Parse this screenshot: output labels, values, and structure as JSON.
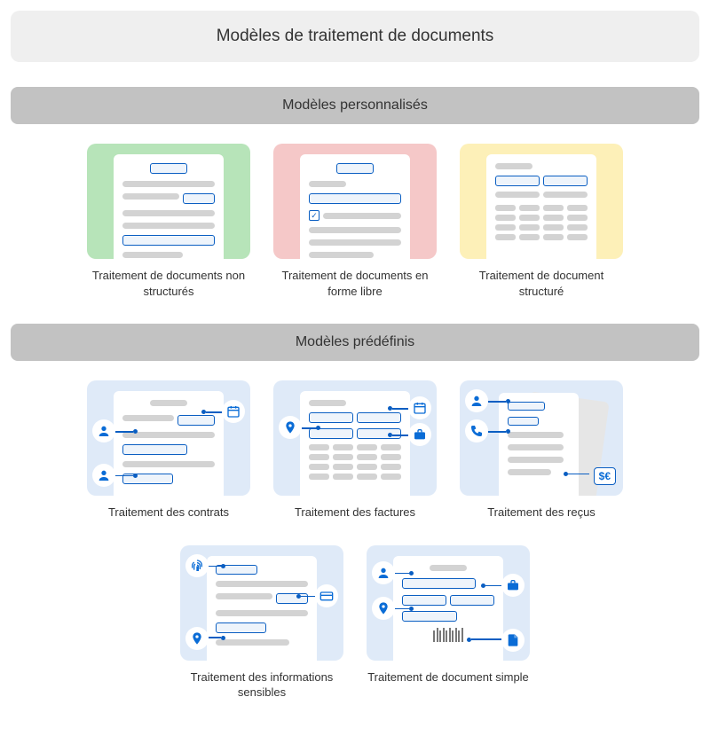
{
  "header": {
    "title": "Modèles de traitement de documents"
  },
  "sections": {
    "custom": {
      "title": "Modèles personnalisés",
      "cards": [
        {
          "caption": "Traitement de documents non structurés"
        },
        {
          "caption": "Traitement de documents en forme libre"
        },
        {
          "caption": "Traitement de document structuré"
        }
      ]
    },
    "prebuilt": {
      "title": "Modèles prédéfinis",
      "cards": [
        {
          "caption": "Traitement des contrats"
        },
        {
          "caption": "Traitement des factures"
        },
        {
          "caption": "Traitement des reçus"
        },
        {
          "caption": "Traitement des informations sensibles"
        },
        {
          "caption": "Traitement de document simple"
        }
      ]
    }
  },
  "icons": {
    "person": "person-icon",
    "calendar": "calendar-icon",
    "location": "location-pin-icon",
    "briefcase": "briefcase-icon",
    "phone": "phone-icon",
    "fingerprint": "fingerprint-icon",
    "creditcard": "credit-card-icon",
    "file": "file-icon",
    "currency": "currency-icon"
  },
  "colors": {
    "green": "#b7e4b9",
    "red": "#f5c8c8",
    "yellow": "#fdf0b8",
    "blue": "#dfeaf8",
    "accent": "#0a6cd6",
    "outline": "#0a5ec2"
  },
  "receipt": {
    "currency_label": "$€"
  }
}
